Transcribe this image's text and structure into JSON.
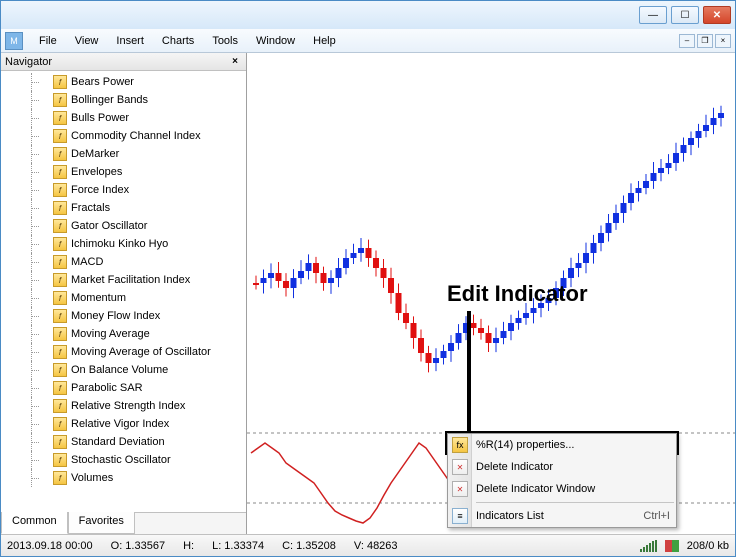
{
  "titlebar": {
    "min": "—",
    "max": "☐",
    "close": "✕"
  },
  "menubar": {
    "items": [
      "File",
      "View",
      "Insert",
      "Charts",
      "Tools",
      "Window",
      "Help"
    ],
    "mdi": {
      "min": "–",
      "restore": "❐",
      "close": "×"
    }
  },
  "navigator": {
    "title": "Navigator",
    "close": "×",
    "items": [
      "Bears Power",
      "Bollinger Bands",
      "Bulls Power",
      "Commodity Channel Index",
      "DeMarker",
      "Envelopes",
      "Force Index",
      "Fractals",
      "Gator Oscillator",
      "Ichimoku Kinko Hyo",
      "MACD",
      "Market Facilitation Index",
      "Momentum",
      "Money Flow Index",
      "Moving Average",
      "Moving Average of Oscillator",
      "On Balance Volume",
      "Parabolic SAR",
      "Relative Strength Index",
      "Relative Vigor Index",
      "Standard Deviation",
      "Stochastic Oscillator",
      "Volumes"
    ],
    "tabs": {
      "a": "Common",
      "b": "Favorites"
    }
  },
  "annotation": {
    "label": "Edit Indicator"
  },
  "context_menu": {
    "properties": "%R(14) properties...",
    "delete_indicator": "Delete Indicator",
    "delete_window": "Delete Indicator Window",
    "list": "Indicators List",
    "list_shortcut": "Ctrl+I"
  },
  "statusbar": {
    "datetime": "2013.09.18 00:00",
    "open": "O: 1.33567",
    "high": "H:",
    "low": "L: 1.33374",
    "close": "C: 1.35208",
    "volume": "V: 48263",
    "traffic": "208/0 kb"
  },
  "chart_data": {
    "type": "candlestick+line",
    "upper": {
      "series": "price candles",
      "note": "approximate OHLC candle positions; exact values unlabeled on screen",
      "candles_count": 63
    },
    "lower": {
      "series": "%R(14) oscillator",
      "note": "red line oscillating; dashed reference levels visible",
      "reference_levels": 2
    }
  }
}
